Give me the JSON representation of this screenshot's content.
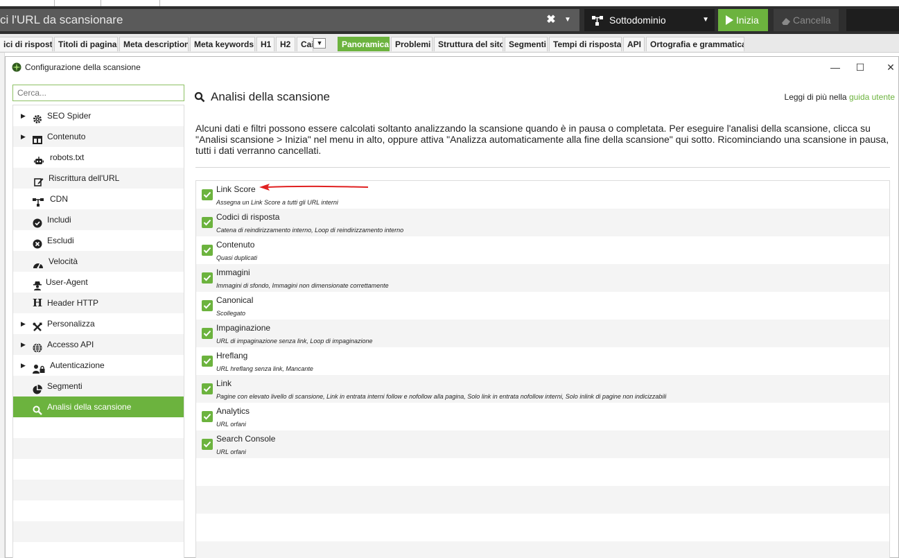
{
  "url_bar": {
    "placeholder": "ci l'URL da scansionare",
    "clear_symbol": "✖",
    "dropdown_symbol": "▼",
    "mode_label": "Sottodominio",
    "start_label": "Inizia",
    "clear_label": "Cancella"
  },
  "tabs": [
    {
      "label": "ici di risposta",
      "active": false
    },
    {
      "label": "Titoli di pagina",
      "active": false
    },
    {
      "label": "Meta description",
      "active": false
    },
    {
      "label": "Meta keywords",
      "active": false
    },
    {
      "label": "H1",
      "active": false
    },
    {
      "label": "H2",
      "active": false
    },
    {
      "label": "Cai",
      "active": false
    },
    {
      "label": "Panoramica",
      "active": true
    },
    {
      "label": "Problemi",
      "active": false
    },
    {
      "label": "Struttura del sito",
      "active": false
    },
    {
      "label": "Segmenti",
      "active": false
    },
    {
      "label": "Tempi di risposta",
      "active": false
    },
    {
      "label": "API",
      "active": false
    },
    {
      "label": "Ortografia e grammatica",
      "active": false
    }
  ],
  "dialog": {
    "title": "Configurazione della scansione",
    "minimize": "—",
    "maximize": "☐",
    "close": "✕"
  },
  "sidebar": {
    "search_placeholder": "Cerca...",
    "items": [
      {
        "label": "SEO Spider",
        "icon": "gear-icon",
        "expandable": true
      },
      {
        "label": "Contenuto",
        "icon": "columns-icon",
        "expandable": true
      },
      {
        "label": "robots.txt",
        "icon": "robot-icon",
        "expandable": false
      },
      {
        "label": "Riscrittura dell'URL",
        "icon": "edit-icon",
        "expandable": false
      },
      {
        "label": "CDN",
        "icon": "network-icon",
        "expandable": false
      },
      {
        "label": "Includi",
        "icon": "check-circle-icon",
        "expandable": false
      },
      {
        "label": "Escludi",
        "icon": "x-circle-icon",
        "expandable": false
      },
      {
        "label": "Velocità",
        "icon": "speedometer-icon",
        "expandable": false
      },
      {
        "label": "User-Agent",
        "icon": "user-secret-icon",
        "expandable": false
      },
      {
        "label": "Header HTTP",
        "icon": "h-icon",
        "expandable": false
      },
      {
        "label": "Personalizza",
        "icon": "tools-icon",
        "expandable": true
      },
      {
        "label": "Accesso API",
        "icon": "globe-icon",
        "expandable": true
      },
      {
        "label": "Autenticazione",
        "icon": "user-lock-icon",
        "expandable": true
      },
      {
        "label": "Segmenti",
        "icon": "pie-chart-icon",
        "expandable": false
      },
      {
        "label": "Analisi della scansione",
        "icon": "search-icon",
        "expandable": false,
        "active": true
      }
    ]
  },
  "content": {
    "title": "Analisi della scansione",
    "read_more_prefix": "Leggi di più nella ",
    "read_more_link": "guida utente",
    "description": "Alcuni dati e filtri possono essere calcolati soltanto analizzando la scansione quando è in pausa o completata. Per eseguire l'analisi della scansione, clicca su \"Analisi scansione > Inizia\" nel menu in alto, oppure attiva \"Analizza automaticamente alla fine della scansione\" qui sotto. Ricominciando una scansione in pausa, tutti i dati verranno cancellati.",
    "options": [
      {
        "name": "Link Score",
        "sub": "Assegna un Link Score a tutti gli URL interni",
        "checked": true
      },
      {
        "name": "Codici di risposta",
        "sub": "Catena di reindirizzamento interno, Loop di reindirizzamento interno",
        "checked": true
      },
      {
        "name": "Contenuto",
        "sub": "Quasi duplicati",
        "checked": true
      },
      {
        "name": "Immagini",
        "sub": "Immagini di sfondo, Immagini non dimensionate correttamente",
        "checked": true
      },
      {
        "name": "Canonical",
        "sub": "Scollegato",
        "checked": true
      },
      {
        "name": "Impaginazione",
        "sub": "URL di impaginazione senza link, Loop di impaginazione",
        "checked": true
      },
      {
        "name": "Hreflang",
        "sub": "URL hreflang senza link, Mancante",
        "checked": true
      },
      {
        "name": "Link",
        "sub": "Pagine con elevato livello di scansione, Link in entrata interni follow e nofollow alla pagina, Solo link in entrata nofollow interni, Solo inlink di pagine non indicizzabili",
        "checked": true
      },
      {
        "name": "Analytics",
        "sub": "URL orfani",
        "checked": true
      },
      {
        "name": "Search Console",
        "sub": "URL orfani",
        "checked": true
      }
    ]
  },
  "colors": {
    "accent": "#6cb33e",
    "annotation_arrow": "#e02020"
  }
}
